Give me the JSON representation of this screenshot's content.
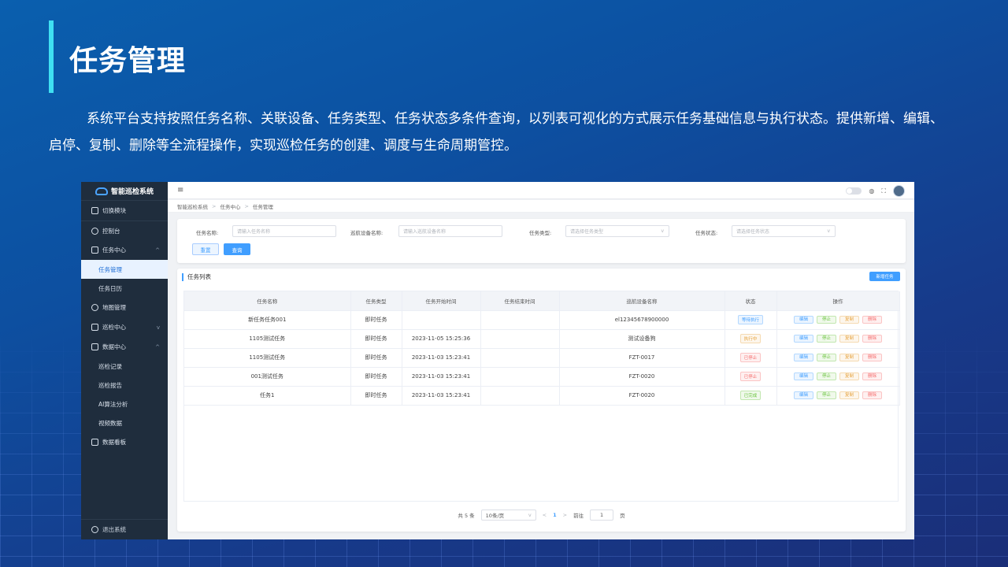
{
  "slide": {
    "title": "任务管理",
    "description": "系统平台支持按照任务名称、关联设备、任务类型、任务状态多条件查询，以列表可视化的方式展示任务基础信息与执行状态。提供新增、编辑、启停、复制、删除等全流程操作，实现巡检任务的创建、调度与生命周期管控。"
  },
  "app": {
    "logo_text": "智能巡检系统",
    "sidebar": {
      "items": [
        {
          "label": "切换模块"
        },
        {
          "label": "控制台"
        },
        {
          "label": "任务中心",
          "expanded": true
        },
        {
          "label": "任务管理",
          "active": true
        },
        {
          "label": "任务日历"
        },
        {
          "label": "地图管理"
        },
        {
          "label": "巡检中心"
        },
        {
          "label": "数据中心",
          "expanded": true
        },
        {
          "label": "巡检记录"
        },
        {
          "label": "巡检报告"
        },
        {
          "label": "AI算法分析"
        },
        {
          "label": "视频数据"
        },
        {
          "label": "数据看板"
        }
      ],
      "logout_label": "退出系统"
    },
    "breadcrumb": [
      "智能巡检系统",
      "任务中心",
      "任务管理"
    ],
    "filters": {
      "task_name_label": "任务名称:",
      "task_name_placeholder": "请输入任务名称",
      "device_label": "巡航设备名称:",
      "device_placeholder": "请输入巡航设备名称",
      "type_label": "任务类型:",
      "type_placeholder": "请选择任务类型",
      "status_label": "任务状态:",
      "status_placeholder": "请选择任务状态",
      "reset_label": "重置",
      "query_label": "查询"
    },
    "list": {
      "title": "任务列表",
      "add_label": "新增任务",
      "columns": [
        "任务名称",
        "任务类型",
        "任务开始时间",
        "任务结束时间",
        "巡航设备名称",
        "状态",
        "操作"
      ],
      "rows": [
        {
          "name": "新任务任务001",
          "type": "即时任务",
          "start": "",
          "end": "",
          "device": "el12345678900000",
          "status": "等待执行",
          "status_kind": "wait"
        },
        {
          "name": "1105测试任务",
          "type": "即时任务",
          "start": "2023-11-05 15:25:36",
          "end": "",
          "device": "测试设备狗",
          "status": "执行中",
          "status_kind": "run"
        },
        {
          "name": "1105测试任务",
          "type": "即时任务",
          "start": "2023-11-03 15:23:41",
          "end": "",
          "device": "FZT-0017",
          "status": "已停止",
          "status_kind": "stop"
        },
        {
          "name": "001测试任务",
          "type": "即时任务",
          "start": "2023-11-03 15:23:41",
          "end": "",
          "device": "FZT-0020",
          "status": "已停止",
          "status_kind": "stop"
        },
        {
          "name": "任务1",
          "type": "即时任务",
          "start": "2023-11-03 15:23:41",
          "end": "",
          "device": "FZT-0020",
          "status": "已完成",
          "status_kind": "done"
        }
      ],
      "ops": {
        "edit": "编辑",
        "pause": "停止",
        "copy": "复制",
        "delete": "删除"
      }
    },
    "pager": {
      "total": "共 5 条",
      "page_size": "10条/页",
      "current_page": "1",
      "goto_label": "前往",
      "goto_value": "1",
      "page_unit": "页"
    }
  }
}
